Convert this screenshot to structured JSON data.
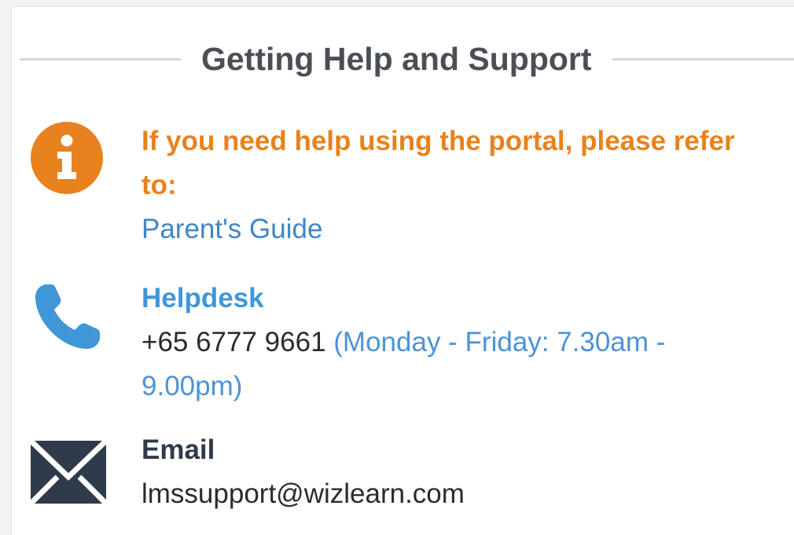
{
  "heading": {
    "title": "Getting Help and Support"
  },
  "help": {
    "icon": "info-icon",
    "message": "If you need help using the portal, please refer to:",
    "link_label": "Parent's Guide"
  },
  "helpdesk": {
    "icon": "phone-icon",
    "label": "Helpdesk",
    "phone": "+65 6777 9661",
    "hours": "(Monday - Friday: 7.30am - 9.00pm)"
  },
  "email": {
    "icon": "envelope-icon",
    "label": "Email",
    "address": "lmssupport@wizlearn.com"
  },
  "colors": {
    "accent_orange": "#e8821e",
    "link_blue": "#3f86c8",
    "phone_blue": "#3f97d8",
    "dark_navy": "#2f3b4a"
  }
}
